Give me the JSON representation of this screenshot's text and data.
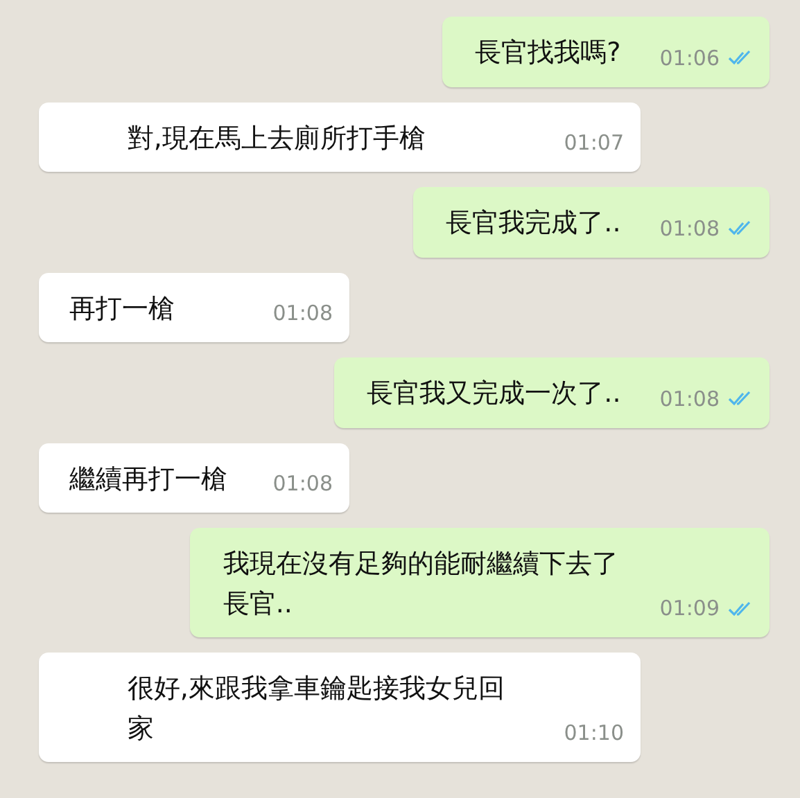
{
  "messages": [
    {
      "kind": "out",
      "text": "長官找我嗎?",
      "time": "01:06",
      "read": true
    },
    {
      "kind": "in",
      "text": "對,現在馬上去廁所打手槍",
      "time": "01:07"
    },
    {
      "kind": "out",
      "text": "長官我完成了..",
      "time": "01:08",
      "read": true
    },
    {
      "kind": "in",
      "text": "再打一槍",
      "time": "01:08"
    },
    {
      "kind": "out",
      "text": "長官我又完成一次了..",
      "time": "01:08",
      "read": true
    },
    {
      "kind": "in",
      "text": "繼續再打一槍",
      "time": "01:08"
    },
    {
      "kind": "out",
      "text": "我現在沒有足夠的能耐繼續下去了長官..",
      "time": "01:09",
      "read": true
    },
    {
      "kind": "in",
      "text": "很好,來跟我拿車鑰匙接我女兒回家",
      "time": "01:10"
    }
  ]
}
